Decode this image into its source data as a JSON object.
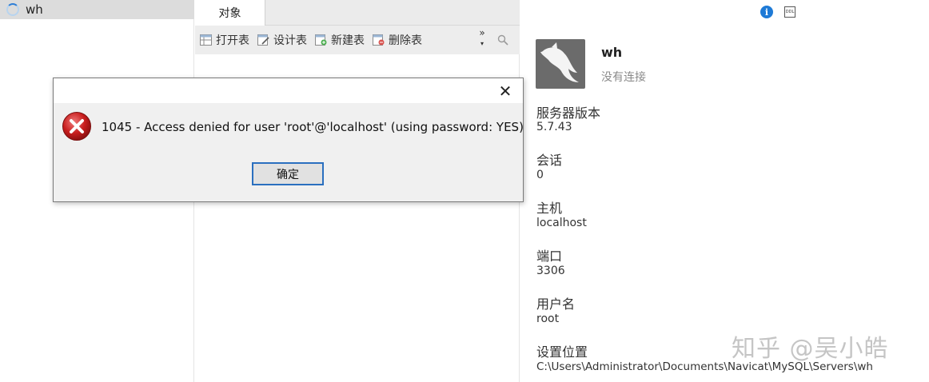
{
  "tree": {
    "items": [
      {
        "label": "wh"
      }
    ]
  },
  "tabs": [
    {
      "label": "对象"
    }
  ],
  "toolbar": {
    "buttons": [
      {
        "label": "打开表"
      },
      {
        "label": "设计表"
      },
      {
        "label": "新建表"
      },
      {
        "label": "删除表"
      }
    ],
    "more": "»"
  },
  "info": {
    "name": "wh",
    "status": "没有连接",
    "fields": [
      {
        "label": "服务器版本",
        "value": "5.7.43"
      },
      {
        "label": "会话",
        "value": "0"
      },
      {
        "label": "主机",
        "value": "localhost"
      },
      {
        "label": "端口",
        "value": "3306"
      },
      {
        "label": "用户名",
        "value": "root"
      },
      {
        "label": "设置位置",
        "value": "C:\\Users\\Administrator\\Documents\\Navicat\\MySQL\\Servers\\wh"
      }
    ]
  },
  "dialog": {
    "message": "1045 - Access denied for user 'root'@'localhost' (using password: YES)",
    "ok_label": "确定"
  },
  "watermark": "知乎 @吴小皓",
  "colors": {
    "accent": "#2a6fbf",
    "error": "#c81e1e"
  }
}
